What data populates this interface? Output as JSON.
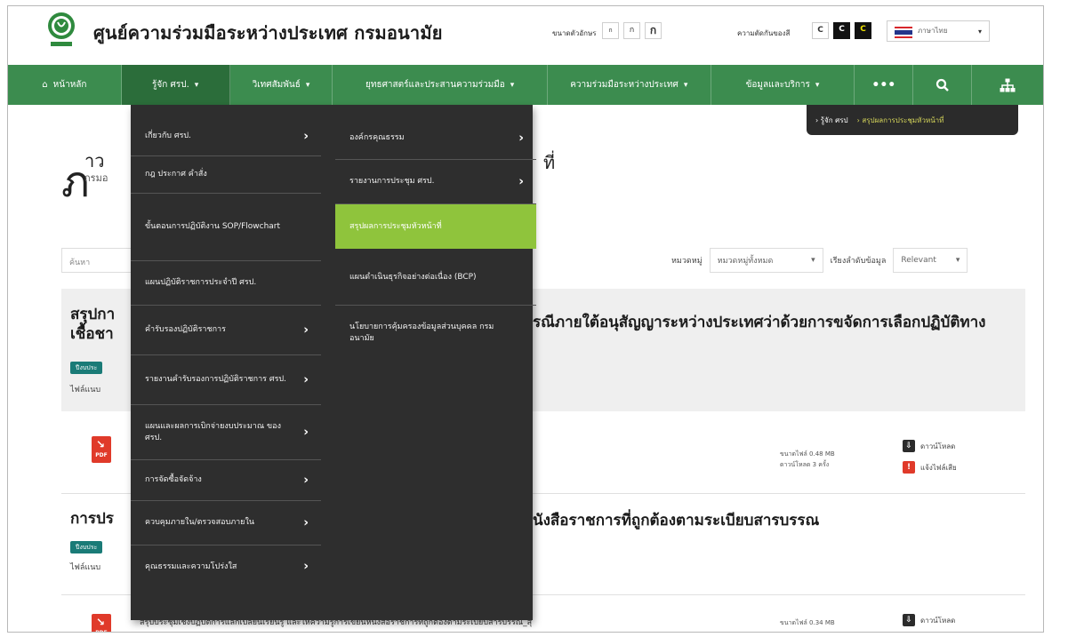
{
  "header": {
    "site_title": "ศูนย์ความร่วมมือระหว่างประเทศ กรมอนามัย",
    "font_size_label": "ขนาดตัวอักษร",
    "font_sizes": [
      "ก",
      "ก",
      "ก"
    ],
    "contrast_label": "ความตัดกันของสี",
    "contrast_options": [
      "C",
      "C",
      "C"
    ],
    "language": "ภาษาไทย"
  },
  "nav": {
    "items": [
      {
        "label": "หน้าหลัก"
      },
      {
        "label": "รู้จัก ศรป."
      },
      {
        "label": "วิเทศสัมพันธ์"
      },
      {
        "label": "ยุทธศาสตร์และประสานความร่วมมือ"
      },
      {
        "label": "ความร่วมมือระหว่างประเทศ"
      },
      {
        "label": "ข้อมูลและบริการ"
      },
      {
        "label": "•••"
      }
    ]
  },
  "breadcrumb": {
    "parent": "› รู้จัก ศรป",
    "current": "› สรุปผลการประชุมหัวหน้าที่"
  },
  "page": {
    "title_initial": "ภ",
    "title_visible": "าว",
    "subtitle": "กรมอ",
    "title_tail": "ที่"
  },
  "filters": {
    "search_placeholder": "ค้นหา",
    "category_label": "หมวดหมู่",
    "category_value": "หมวดหมู่ทั้งหมด",
    "sort_label": "เรียงลำดับข้อมูล",
    "sort_value": "Relevant"
  },
  "mega_menu": {
    "col1": [
      {
        "label": "เกี่ยวกับ ศรป.",
        "has_sub": true
      },
      {
        "label": "กฎ ประกาศ คำสั่ง",
        "has_sub": false
      },
      {
        "label": "ขั้นตอนการปฏิบัติงาน SOP/Flowchart",
        "has_sub": false
      },
      {
        "label": "แผนปฏิบัติราชการประจำปี ศรป.",
        "has_sub": false
      },
      {
        "label": "คำรับรองปฏิบัติราชการ",
        "has_sub": true
      },
      {
        "label": "รายงานคำรับรองการปฏิบัติราชการ ศรป.",
        "has_sub": true
      },
      {
        "label": "แผนและผลการเบิกจ่ายงบประมาณ ของ ศรป.",
        "has_sub": true
      },
      {
        "label": "การจัดซื้อจัดจ้าง",
        "has_sub": true
      },
      {
        "label": "ควบคุมภายใน/ตรวจสอบภายใน",
        "has_sub": true
      },
      {
        "label": "คุณธรรมและความโปร่งใส",
        "has_sub": true
      }
    ],
    "col2": [
      {
        "label": "องค์กรคุณธรรม",
        "has_sub": true
      },
      {
        "label": "รายงานการประชุม ศรป.",
        "has_sub": true
      },
      {
        "label": "สรุปผลการประชุมหัวหน้าที่",
        "has_sub": false
      },
      {
        "label": "แผนดำเนินธุรกิจอย่างต่อเนื่อง (BCP)",
        "has_sub": false
      },
      {
        "label": "นโยบายการคุ้มครองข้อมูลส่วนบุคคล กรมอนามัย",
        "has_sub": false
      }
    ]
  },
  "results": [
    {
      "title_start": "สรุปกา",
      "title_line2": "เชื้อชา",
      "title_right": "รณีภายใต้อนุสัญญาระหว่างประเทศว่าด้วยการขจัดการเลือกปฏิบัติทาง",
      "tag": "ปีงบประ",
      "filetype": "ไฟล์แนบ",
      "file_size": "ขนาดไฟล์ 0.48 MB",
      "downloads": "ดาวน์โหลด 3 ครั้ง",
      "download_label": "ดาวน์โหลด",
      "report_label": "แจ้งไฟล์เสีย"
    },
    {
      "title_start": "การปร",
      "title_right": "นังสือราชการที่ถูกต้องตามระเบียบสารบรรณ",
      "tag": "ปีงบประ",
      "filetype": "ไฟล์แนบ",
      "file_name": "สรุปประชุมเชิงปฏิบัติการแลกเปลี่ยนเรียนรู้ และให้ความรู้การเขียนหนังสือราชการที่ถูกต้องตามระเบียบสารบรรณ_สุ",
      "file_size": "ขนาดไฟล์ 0.34 MB",
      "download_label": "ดาวน์โหลด"
    }
  ],
  "colors": {
    "nav_green": "#3c8c4f",
    "menu_dark": "#2e2e2e",
    "highlight": "#8fc43c",
    "tag_teal": "#1a7b77"
  }
}
